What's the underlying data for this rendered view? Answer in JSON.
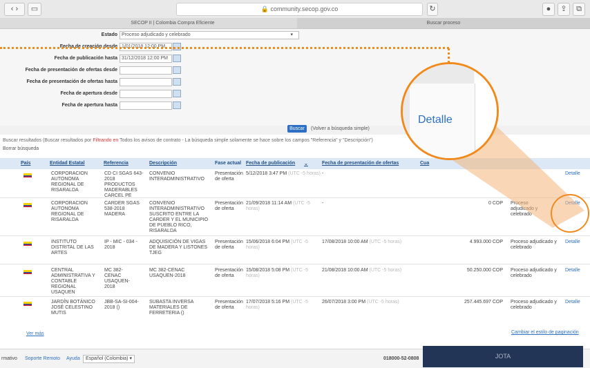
{
  "browser": {
    "address": "community.secop.gov.co",
    "tabs": [
      "SECOP II | Colombia Compra Eficiente",
      "Buscar proceso"
    ]
  },
  "form": {
    "estado_label": "Estado",
    "estado_value": "Proceso adjudicado y celebrado",
    "fields": [
      {
        "label": "Fecha de creación desde",
        "value": "1/01/2018 12:00 PM"
      },
      {
        "label": "Fecha de publicación hasta",
        "value": "31/12/2018 12:00 PM"
      },
      {
        "label": "Fecha de presentación de ofertas desde",
        "value": ""
      },
      {
        "label": "Fecha de presentación de ofertas hasta",
        "value": ""
      },
      {
        "label": "Fecha de apertura desde",
        "value": ""
      },
      {
        "label": "Fecha de apertura hasta",
        "value": ""
      }
    ],
    "buscar_label": "Buscar",
    "simple_link": "(Volver a búsqueda simple)"
  },
  "results": {
    "info_prefix": "Buscar resultados (Buscar resultados por ",
    "info_red": "Filtrando en",
    "info_suffix": " Todos los avisos de contrato - La búsqueda simple solamente se hace sobre los campos \"Referencia\" y \"Descripción\")",
    "borrar": "Borrar búsqueda",
    "headers": [
      "País",
      "Entidad Estatal",
      "Referencia",
      "Descripción",
      "Fase actual",
      "Fecha de publicación",
      "Fecha de presentación de ofertas",
      "Cua"
    ],
    "rows": [
      {
        "entidad": "CORPORACION AUTONOMA REGIONAL DE RISARALDA",
        "referencia": "CD CI SGAS 643-2018 PRODUCTOS MADERABLES CARCEL PE",
        "descripcion": "CONVENIO INTERADMINISTRATIVO",
        "fase": "Presentación de oferta",
        "pub": "5/12/2018 3:47 PM",
        "pub_tz": "(UTC -5 horas)",
        "pres": "-",
        "precio": "",
        "estado": "",
        "accion": "Detalle"
      },
      {
        "entidad": "CORPORACION AUTONOMA REGIONAL DE RISARALDA",
        "referencia": "CARDER SGAS 538-2018 MADERA",
        "descripcion": "CONVENIO INTERADMINISTRATIVO SUSCRITO ENTRE LA CARDER Y EL MUNICIPIO DE PUEBLO RICO, RISARALDA",
        "fase": "Presentación de oferta",
        "pub": "21/09/2018 11:14 AM",
        "pub_tz": "(UTC -5 horas)",
        "pres": "-",
        "precio": "0 COP",
        "estado": "Proceso adjudicado y celebrado",
        "accion": "Detalle"
      },
      {
        "entidad": "INSTITUTO DISTRITAL DE LAS ARTES",
        "referencia": "IP - MIC - 034 - 2018",
        "descripcion": "ADQUISICIÓN DE VIGAS DE MADERA Y LISTONES TJEG",
        "fase": "Presentación de oferta",
        "pub": "15/06/2018 6:04 PM",
        "pub_tz": "(UTC -5 horas)",
        "pres": "17/08/2018 10:00 AM",
        "pres_tz": "(UTC -5 horas)",
        "precio": "4.993.000 COP",
        "estado": "Proceso adjudicado y celebrado",
        "accion": "Detalle"
      },
      {
        "entidad": "CENTRAL ADMINISTRATIVA Y CONTABLE REGIONAL USAQUEN",
        "referencia": "MC 382-CENAC USAQUEN-2018",
        "descripcion": "MC 382-CENAC USAQUEN-2018",
        "fase": "Presentación de oferta",
        "pub": "15/08/2018 5:08 PM",
        "pub_tz": "(UTC -5 horas)",
        "pres": "21/08/2018 10:00 AM",
        "pres_tz": "(UTC -5 horas)",
        "precio": "50.250.000 COP",
        "estado": "Proceso adjudicado y celebrado",
        "accion": "Detalle"
      },
      {
        "entidad": "JARDÍN BOTÁNICO JOSÉ CELESTINO MUTIS",
        "referencia": "JBB-SA-SI-004-2018 ()",
        "descripcion": "SUBASTA INVERSA MATERIALES DE FERRETERIA ()",
        "fase": "Presentación de oferta",
        "pub": "17/07/2018 5:16 PM",
        "pub_tz": "(UTC -5 horas)",
        "pres": "26/07/2018 3:00 PM",
        "pres_tz": "(UTC -5 horas)",
        "precio": "257.445.697 COP",
        "estado": "Proceso adjudicado y celebrado",
        "accion": "Detalle"
      }
    ],
    "ver_mas": "Ver más",
    "paginacion": "Cambiar el estilo de paginación"
  },
  "zoom_label": "Detalle",
  "footer": {
    "items": [
      "rmativo",
      "Soporte Remoto",
      "Ayuda"
    ],
    "language": "Español (Colombia)",
    "phone": "018000-52-0808",
    "jota": "JOTA"
  },
  "colors": {
    "accent": "#2d6fc4",
    "highlight": "#f08a1c",
    "header_bg": "#dce8f5"
  }
}
